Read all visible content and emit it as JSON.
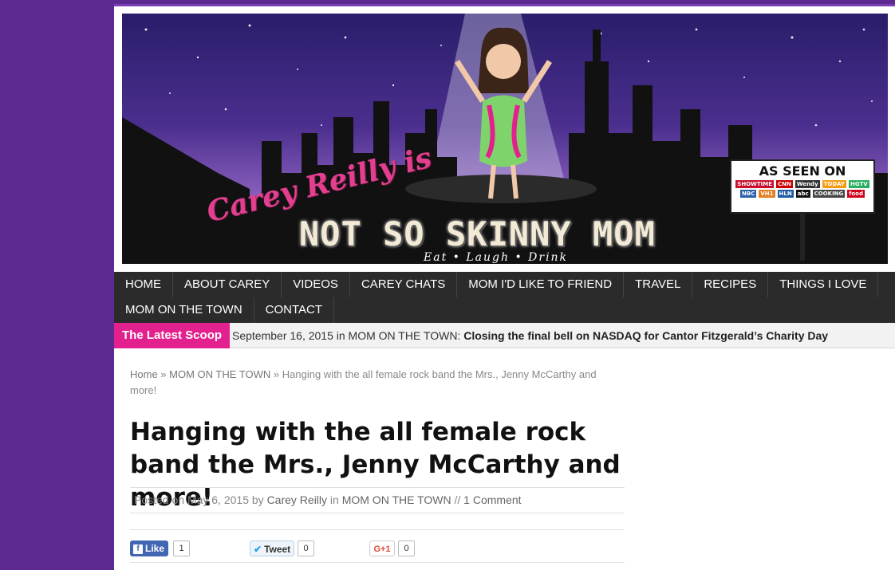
{
  "header": {
    "script_name": "Carey Reilly is",
    "title": "NOT SO SKINNY MOM",
    "tagline": "Eat • Laugh • Drink",
    "as_seen_on": "AS SEEN ON",
    "networks": [
      "SHOWTIME",
      "CNN",
      "Wendy",
      "TODAY",
      "HGTV",
      "NBC",
      "VH1",
      "HLN",
      "abc",
      "COOKING",
      "food"
    ]
  },
  "nav": {
    "row1": [
      "HOME",
      "ABOUT CAREY",
      "VIDEOS",
      "CAREY CHATS",
      "MOM I'D LIKE TO FRIEND",
      "TRAVEL",
      "RECIPES",
      "THINGS I LOVE"
    ],
    "row2": [
      "MOM ON THE TOWN",
      "CONTACT"
    ]
  },
  "scoop": {
    "tag": "The Latest Scoop",
    "date_prefix": "September 16, 2015 in MOM ON THE TOWN:",
    "headline": "Closing the final bell on NASDAQ for Cantor Fitzgerald’s Charity Day"
  },
  "breadcrumb": {
    "home": "Home",
    "sep1": " » ",
    "category": "MOM ON THE TOWN",
    "sep2": " » ",
    "current": "Hanging with the all female rock band the Mrs., Jenny McCarthy and more!"
  },
  "post": {
    "title": "Hanging with the all female rock band the Mrs., Jenny McCarthy and more!",
    "posted_on": "Posted on May 6, 2015 by ",
    "author": "Carey Reilly",
    "in_text": " in ",
    "category": "MOM ON THE TOWN",
    "sep": " // ",
    "comments": "1 Comment"
  },
  "share": {
    "facebook_label": "Like",
    "facebook_count": "1",
    "twitter_label": "Tweet",
    "twitter_count": "0",
    "gplus_label": "G+1",
    "gplus_count": "0"
  },
  "colors": {
    "background": "#5d2a92",
    "nav": "#2b2b2b",
    "accent_pink": "#e3218e"
  }
}
